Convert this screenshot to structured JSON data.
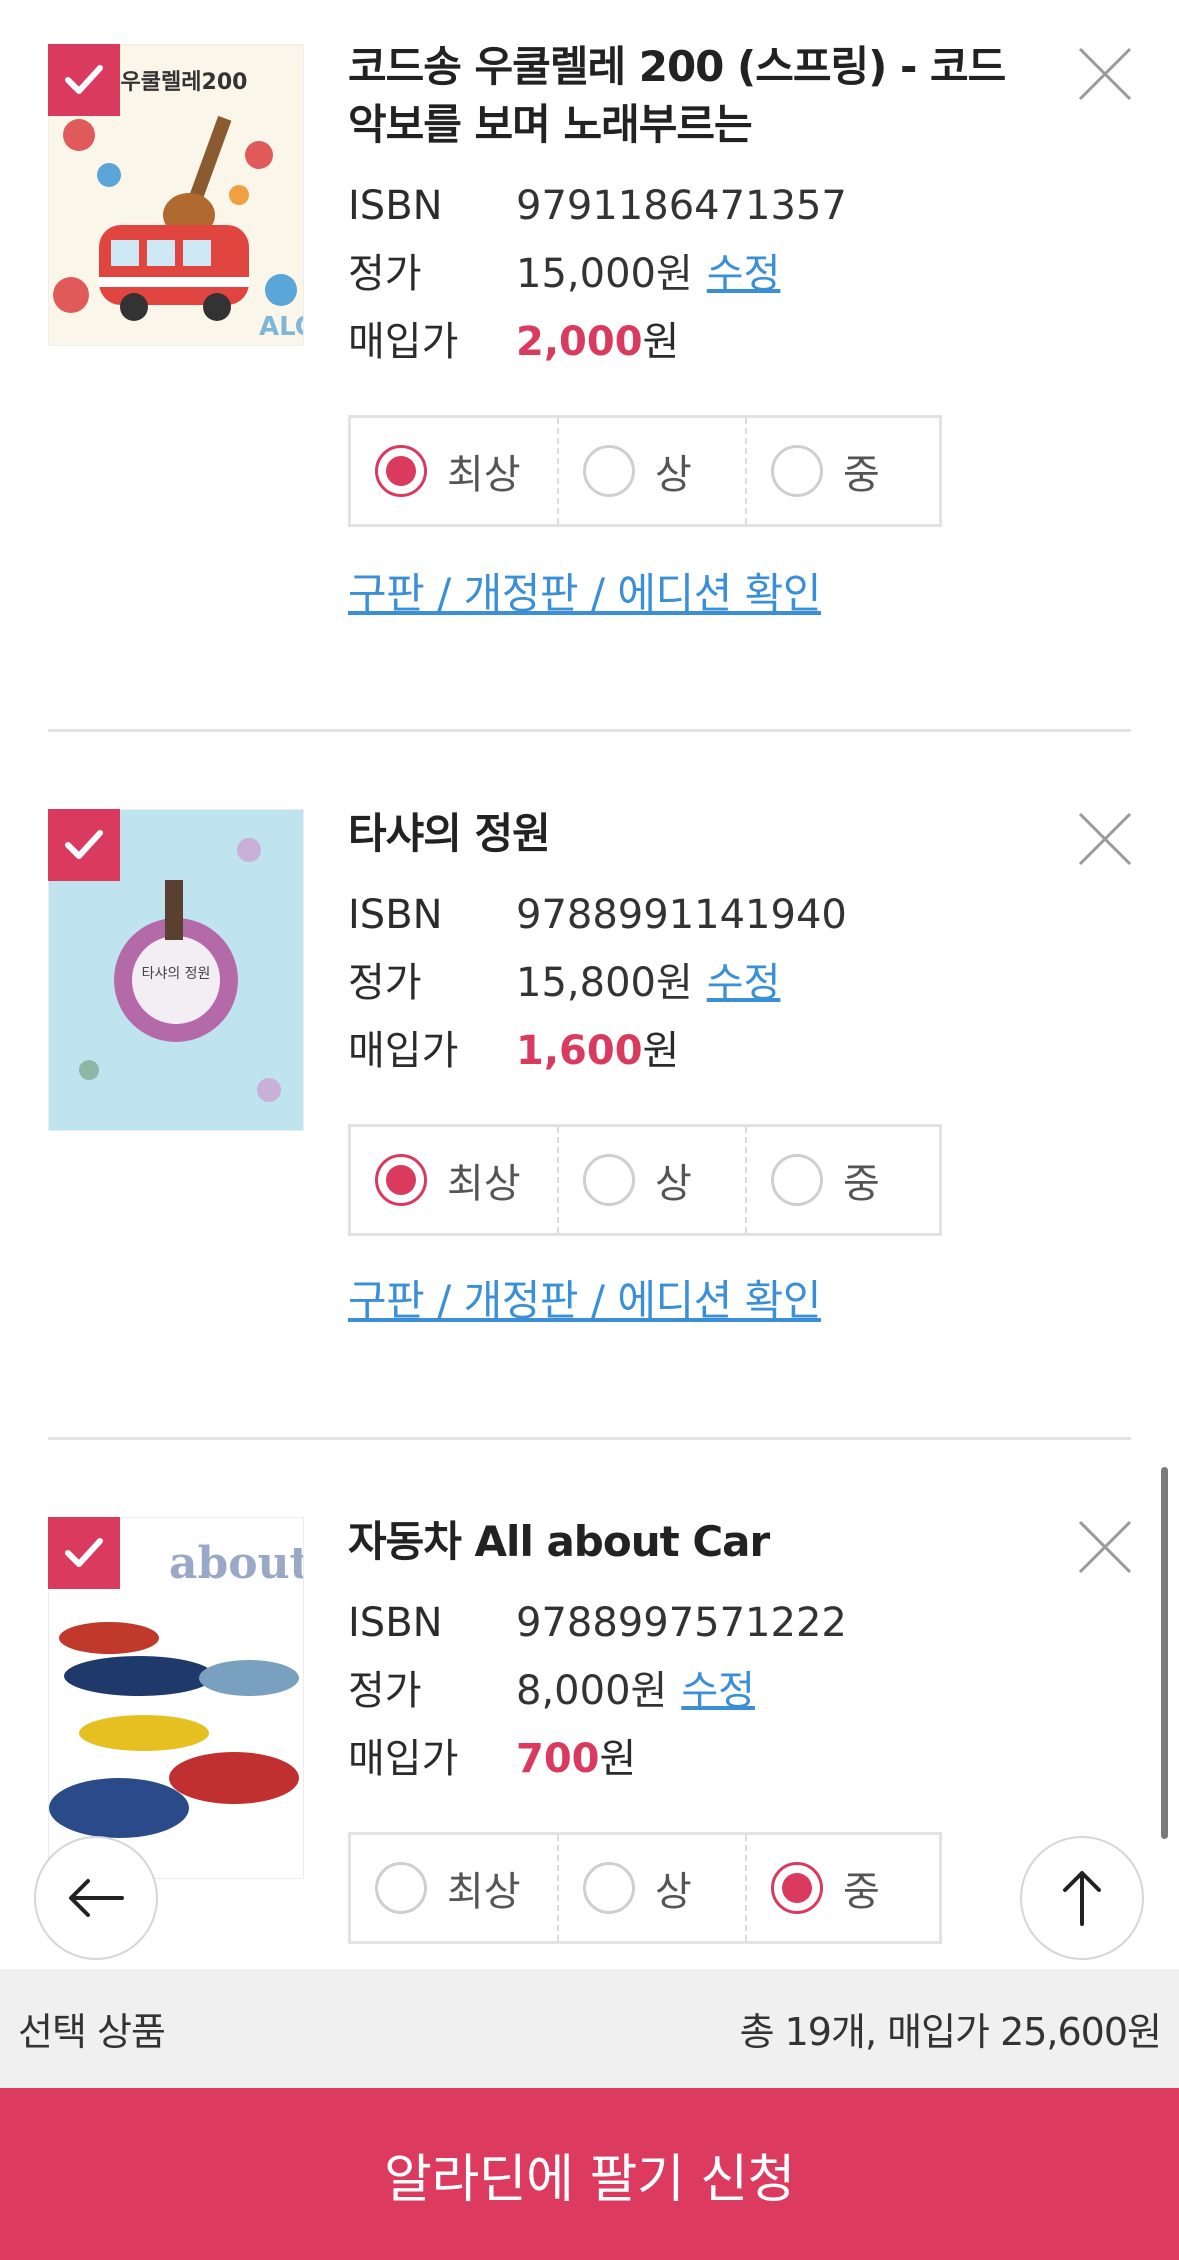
{
  "books": [
    {
      "title": "코드송 우쿨렐레 200 (스프링) - 코드악보를 보며 노래부르는",
      "cover_text": "우쿨렐레200",
      "isbn_label": "ISBN",
      "isbn": "9791186471357",
      "list_label": "정가",
      "list_price": "15,000원",
      "edit_label": "수정",
      "buy_label": "매입가",
      "buy_price": "2,000",
      "won": "원",
      "conditions": [
        "최상",
        "상",
        "중"
      ],
      "selected_condition": "최상",
      "edition_link": "구판 / 개정판 / 에디션 확인"
    },
    {
      "title": "타샤의 정원",
      "cover_text": "타샤의 정원",
      "isbn_label": "ISBN",
      "isbn": "9788991141940",
      "list_label": "정가",
      "list_price": "15,800원",
      "edit_label": "수정",
      "buy_label": "매입가",
      "buy_price": "1,600",
      "won": "원",
      "conditions": [
        "최상",
        "상",
        "중"
      ],
      "selected_condition": "최상",
      "edition_link": "구판 / 개정판 / 에디션 확인"
    },
    {
      "title": "자동차 All about Car",
      "cover_text": "about CAR 자동차",
      "isbn_label": "ISBN",
      "isbn": "9788997571222",
      "list_label": "정가",
      "list_price": "8,000원",
      "edit_label": "수정",
      "buy_label": "매입가",
      "buy_price": "700",
      "won": "원",
      "conditions": [
        "최상",
        "상",
        "중"
      ],
      "selected_condition": "중"
    }
  ],
  "summary": {
    "label": "선택 상품",
    "total": "총 19개, 매입가 25,600원"
  },
  "cta": {
    "label": "알라딘에 팔기 신청"
  },
  "colors": {
    "accent": "#dc3b5f",
    "link": "#3a8fd6"
  },
  "icons": {
    "check": "check-icon",
    "close": "close-icon",
    "back": "arrow-left-icon",
    "top": "arrow-up-icon"
  }
}
